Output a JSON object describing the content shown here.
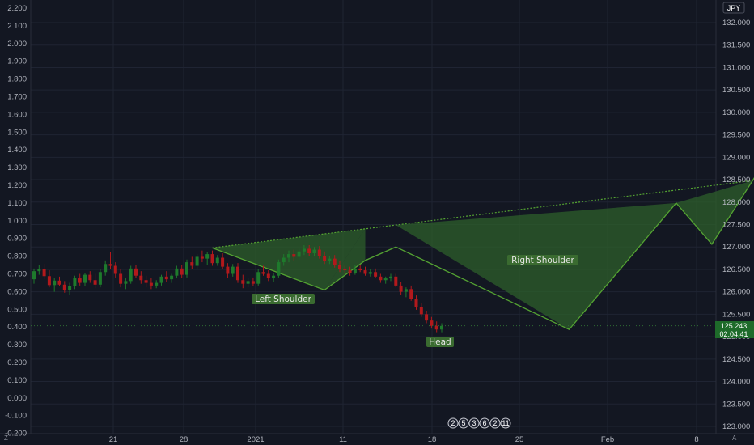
{
  "chart_data": {
    "type": "candlestick",
    "currency_label": "JPY",
    "left_axis": {
      "ticks": [
        "2.200",
        "2.100",
        "2.000",
        "1.900",
        "1.800",
        "1.700",
        "1.600",
        "1.500",
        "1.400",
        "1.300",
        "1.200",
        "1.100",
        "1.000",
        "0.900",
        "0.800",
        "0.700",
        "0.600",
        "0.500",
        "0.400",
        "0.300",
        "0.200",
        "0.100",
        "0.000",
        "-0.100",
        "-0.200"
      ]
    },
    "right_axis": {
      "ticks": [
        "132.000",
        "131.500",
        "131.000",
        "130.500",
        "130.000",
        "129.500",
        "129.000",
        "128.500",
        "128.000",
        "127.500",
        "127.000",
        "126.500",
        "126.000",
        "125.500",
        "125.000",
        "124.500",
        "124.000",
        "123.500",
        "123.000"
      ],
      "ylim": [
        122.95,
        132.45
      ]
    },
    "x_axis": {
      "ticks": [
        "21",
        "28",
        "2021",
        "11",
        "18",
        "25",
        "Feb",
        "8"
      ]
    },
    "last_price": "125.243",
    "countdown": "02:04:41",
    "corner_left": "Z",
    "corner_right": "A",
    "candles": [
      [
        126.28,
        126.52,
        126.18,
        126.46
      ],
      [
        126.46,
        126.6,
        126.38,
        126.5
      ],
      [
        126.5,
        126.62,
        126.28,
        126.35
      ],
      [
        126.35,
        126.48,
        126.1,
        126.15
      ],
      [
        126.15,
        126.3,
        126.0,
        126.25
      ],
      [
        126.25,
        126.34,
        126.12,
        126.16
      ],
      [
        126.16,
        126.24,
        125.98,
        126.04
      ],
      [
        126.04,
        126.2,
        125.94,
        126.12
      ],
      [
        126.12,
        126.36,
        126.06,
        126.3
      ],
      [
        126.3,
        126.4,
        126.14,
        126.2
      ],
      [
        126.2,
        126.42,
        126.12,
        126.38
      ],
      [
        126.38,
        126.46,
        126.2,
        126.26
      ],
      [
        126.26,
        126.4,
        126.08,
        126.16
      ],
      [
        126.16,
        126.5,
        126.1,
        126.44
      ],
      [
        126.44,
        126.7,
        126.36,
        126.62
      ],
      [
        126.62,
        126.88,
        126.5,
        126.58
      ],
      [
        126.58,
        126.66,
        126.32,
        126.4
      ],
      [
        126.4,
        126.5,
        126.1,
        126.18
      ],
      [
        126.18,
        126.3,
        126.06,
        126.24
      ],
      [
        126.24,
        126.58,
        126.18,
        126.52
      ],
      [
        126.52,
        126.6,
        126.3,
        126.36
      ],
      [
        126.36,
        126.46,
        126.18,
        126.26
      ],
      [
        126.26,
        126.36,
        126.1,
        126.2
      ],
      [
        126.2,
        126.3,
        126.06,
        126.14
      ],
      [
        126.14,
        126.26,
        126.08,
        126.2
      ],
      [
        126.2,
        126.38,
        126.14,
        126.34
      ],
      [
        126.34,
        126.46,
        126.22,
        126.28
      ],
      [
        126.28,
        126.4,
        126.2,
        126.36
      ],
      [
        126.36,
        126.58,
        126.3,
        126.52
      ],
      [
        126.52,
        126.6,
        126.3,
        126.38
      ],
      [
        126.38,
        126.72,
        126.32,
        126.66
      ],
      [
        126.66,
        126.78,
        126.5,
        126.58
      ],
      [
        126.58,
        126.84,
        126.5,
        126.78
      ],
      [
        126.78,
        126.92,
        126.66,
        126.74
      ],
      [
        126.74,
        126.88,
        126.6,
        126.84
      ],
      [
        126.84,
        126.92,
        126.58,
        126.64
      ],
      [
        126.64,
        126.82,
        126.58,
        126.76
      ],
      [
        126.76,
        126.86,
        126.5,
        126.56
      ],
      [
        126.56,
        126.64,
        126.3,
        126.4
      ],
      [
        126.4,
        126.62,
        126.34,
        126.56
      ],
      [
        126.56,
        126.64,
        126.2,
        126.26
      ],
      [
        126.26,
        126.38,
        126.08,
        126.18
      ],
      [
        126.18,
        126.32,
        126.1,
        126.24
      ],
      [
        126.24,
        126.32,
        126.12,
        126.18
      ],
      [
        126.18,
        126.5,
        126.14,
        126.44
      ],
      [
        126.44,
        126.58,
        126.36,
        126.4
      ],
      [
        126.4,
        126.48,
        126.24,
        126.3
      ],
      [
        126.3,
        126.42,
        126.22,
        126.36
      ],
      [
        126.36,
        126.72,
        126.32,
        126.66
      ],
      [
        126.66,
        126.84,
        126.58,
        126.76
      ],
      [
        126.76,
        126.92,
        126.66,
        126.84
      ],
      [
        126.84,
        126.94,
        126.7,
        126.78
      ],
      [
        126.78,
        126.96,
        126.72,
        126.9
      ],
      [
        126.9,
        127.04,
        126.82,
        126.96
      ],
      [
        126.96,
        127.04,
        126.8,
        126.86
      ],
      [
        126.86,
        127.0,
        126.8,
        126.94
      ],
      [
        126.94,
        127.02,
        126.74,
        126.8
      ],
      [
        126.8,
        126.9,
        126.62,
        126.68
      ],
      [
        126.68,
        126.8,
        126.62,
        126.74
      ],
      [
        126.74,
        126.82,
        126.54,
        126.6
      ],
      [
        126.6,
        126.7,
        126.44,
        126.5
      ],
      [
        126.5,
        126.58,
        126.4,
        126.48
      ],
      [
        126.48,
        126.56,
        126.36,
        126.42
      ],
      [
        126.42,
        126.6,
        126.38,
        126.52
      ],
      [
        126.52,
        126.6,
        126.44,
        126.48
      ],
      [
        126.48,
        126.56,
        126.36,
        126.4
      ],
      [
        126.4,
        126.5,
        126.34,
        126.44
      ],
      [
        126.44,
        126.52,
        126.3,
        126.34
      ],
      [
        126.34,
        126.4,
        126.2,
        126.26
      ],
      [
        126.26,
        126.34,
        126.18,
        126.3
      ],
      [
        126.3,
        126.4,
        126.24,
        126.34
      ],
      [
        126.34,
        126.4,
        126.1,
        126.14
      ],
      [
        126.14,
        126.22,
        125.94,
        126.0
      ],
      [
        126.0,
        126.1,
        125.88,
        126.06
      ],
      [
        126.06,
        126.14,
        125.8,
        125.84
      ],
      [
        125.84,
        125.92,
        125.6,
        125.66
      ],
      [
        125.66,
        125.74,
        125.44,
        125.5
      ],
      [
        125.5,
        125.58,
        125.3,
        125.36
      ],
      [
        125.36,
        125.44,
        125.18,
        125.24
      ],
      [
        125.24,
        125.34,
        125.1,
        125.16
      ],
      [
        125.16,
        125.3,
        125.1,
        125.24
      ]
    ],
    "pattern": {
      "points": [
        [
          0,
          126.98
        ],
        [
          22,
          126.04
        ],
        [
          30,
          126.7
        ],
        [
          36,
          127.0
        ],
        [
          70,
          125.16
        ],
        [
          91,
          127.98
        ],
        [
          98,
          127.06
        ],
        [
          106,
          128.48
        ],
        [
          116,
          130.38
        ]
      ],
      "neckline": [
        [
          0,
          126.98
        ],
        [
          106,
          128.48
        ]
      ]
    },
    "annotations": [
      "Left Shoulder",
      "Head",
      "Right Shoulder"
    ],
    "bottom_badges": [
      "2",
      "5",
      "3",
      "6",
      "2",
      "11"
    ],
    "colors": {
      "background": "#131722",
      "grid": "#1f2433",
      "axis_text": "#b2b5be",
      "up_candle": "#1e7a2c",
      "down_candle": "#b2191c",
      "pattern_fill": "#2e5f2b",
      "pattern_line": "#54a332",
      "label_bg": "#3a6b30",
      "price_label_bg": "#1e6b2a"
    }
  }
}
